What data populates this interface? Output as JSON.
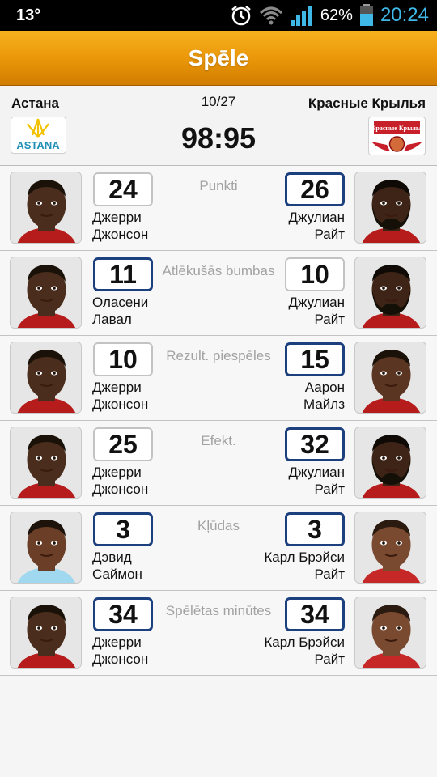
{
  "status_bar": {
    "temperature": "13°",
    "battery_percent": "62%",
    "battery_level": 0.62,
    "time": "20:24"
  },
  "title": "Spēle",
  "match": {
    "home_team": "Астана",
    "away_team": "Красные Крылья",
    "date": "10/27",
    "score": "98:95",
    "home_logo_text": "ASTANA",
    "away_logo_text": "Красные Крылья"
  },
  "stats": [
    {
      "label": "Punkti",
      "left": {
        "value": "24",
        "first": "Джерри",
        "last": "Джонсон"
      },
      "right": {
        "value": "26",
        "first": "Джулиан",
        "last": "Райт"
      },
      "highlight": "right"
    },
    {
      "label": "Atlēkušās bumbas",
      "left": {
        "value": "11",
        "first": "Оласени",
        "last": "Лавал"
      },
      "right": {
        "value": "10",
        "first": "Джулиан",
        "last": "Райт"
      },
      "highlight": "left"
    },
    {
      "label": "Rezult. piespēles",
      "left": {
        "value": "10",
        "first": "Джерри",
        "last": "Джонсон"
      },
      "right": {
        "value": "15",
        "first": "Аарон",
        "last": "Майлз"
      },
      "highlight": "right"
    },
    {
      "label": "Efekt.",
      "left": {
        "value": "25",
        "first": "Джерри",
        "last": "Джонсон"
      },
      "right": {
        "value": "32",
        "first": "Джулиан",
        "last": "Райт"
      },
      "highlight": "right"
    },
    {
      "label": "Kļūdas",
      "left": {
        "value": "3",
        "first": "Дэвид",
        "last": "Саймон"
      },
      "right": {
        "value": "3",
        "first": "Карл Брэйси",
        "last": "Райт"
      },
      "highlight": "both"
    },
    {
      "label": "Spēlētas minūtes",
      "left": {
        "value": "34",
        "first": "Джерри",
        "last": "Джонсон"
      },
      "right": {
        "value": "34",
        "first": "Карл Брэйси",
        "last": "Райт"
      },
      "highlight": "both"
    }
  ],
  "colors": {
    "accent_orange": "#e99508",
    "highlight_border": "#1c3f7e",
    "status_time": "#3fb8e8",
    "battery": "#3fb8e8"
  }
}
